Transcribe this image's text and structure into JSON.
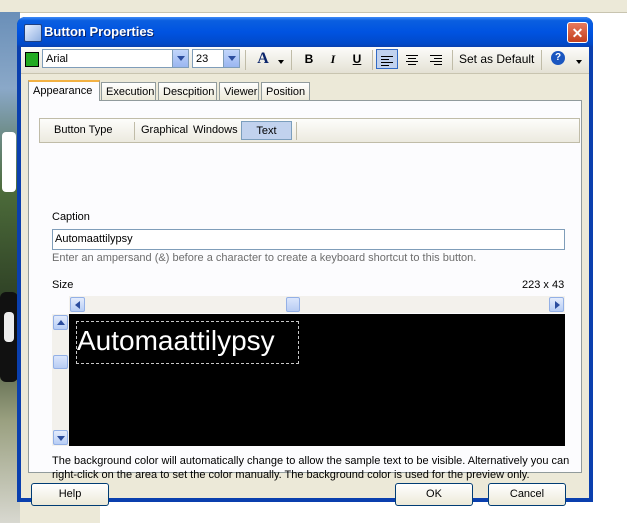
{
  "dialog": {
    "title": "Button Properties"
  },
  "toolbar": {
    "font_color": "#22aa22",
    "font_name": "Arial",
    "font_size": "23",
    "font_color_button_label": "A",
    "bold_label": "B",
    "italic_label": "I",
    "underline_label": "U",
    "set_default_label": "Set as Default",
    "help_glyph": "?",
    "active_alignment": "left"
  },
  "tabs": [
    {
      "label": "Appearance",
      "active": true
    },
    {
      "label": "Execution",
      "active": false
    },
    {
      "label": "Descpition",
      "active": false
    },
    {
      "label": "Viewer",
      "active": false
    },
    {
      "label": "Position",
      "active": false
    }
  ],
  "button_type": {
    "label": "Button Type",
    "options": [
      {
        "label": "Graphical",
        "active": false
      },
      {
        "label": "Windows",
        "active": false
      },
      {
        "label": "Text",
        "active": true
      }
    ]
  },
  "caption": {
    "label": "Caption",
    "value": "Automaattilypsy",
    "hint": "Enter an ampersand (&) before a character to create a keyboard shortcut to this button."
  },
  "size": {
    "label": "Size",
    "value": "223 x 43"
  },
  "preview": {
    "text": "Automaattilypsy",
    "background": "#000000",
    "text_color": "#ffffff",
    "note": "The background color will automatically change to allow the sample text to be visible. Alternatively you can right-click on the area to set the color manually. The background color is used for the preview only."
  },
  "footer": {
    "help_label": "Help",
    "ok_label": "OK",
    "cancel_label": "Cancel"
  }
}
